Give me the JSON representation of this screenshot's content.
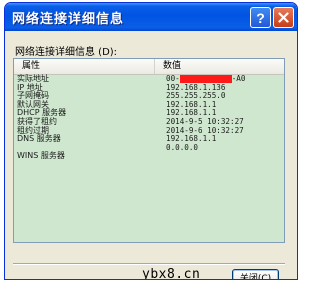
{
  "window": {
    "title": "网络连接详细信息",
    "help_icon": "question-mark-icon",
    "close_icon": "close-x-icon",
    "title_color": "#0054e3",
    "close_color": "#c53d16"
  },
  "group": {
    "label": "网络连接详细信息 (D):"
  },
  "table": {
    "headers": [
      "属性",
      "数值"
    ],
    "background": "#cfe7cf",
    "rows": [
      {
        "property": "实际地址",
        "value_prefix": "00-",
        "value_suffix": "-A0",
        "redacted": true,
        "redaction_color": "#ff1a1a"
      },
      {
        "property": "IP 地址",
        "value": "192.168.1.136"
      },
      {
        "property": "子网掩码",
        "value": "255.255.255.0"
      },
      {
        "property": "默认网关",
        "value": "192.168.1.1"
      },
      {
        "property": "DHCP 服务器",
        "value": "192.168.1.1"
      },
      {
        "property": "获得了租约",
        "value": "2014-9-5 10:32:27"
      },
      {
        "property": "租约过期",
        "value": "2014-9-6 10:32:27"
      },
      {
        "property": "DNS 服务器",
        "value": "192.168.1.1"
      },
      {
        "property": "",
        "value": "0.0.0.0"
      },
      {
        "property": "WINS 服务器",
        "value": ""
      }
    ]
  },
  "footer": {
    "watermark": "ybx8.cn",
    "close_label": "关闭(C)"
  }
}
